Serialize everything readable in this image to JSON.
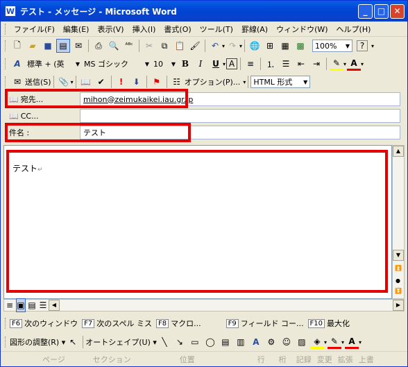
{
  "window": {
    "title": "テスト - メッセージ - Microsoft Word",
    "app_icon": "W"
  },
  "menu": [
    "ファイル(F)",
    "編集(E)",
    "表示(V)",
    "挿入(I)",
    "書式(O)",
    "ツール(T)",
    "罫線(A)",
    "ウィンドウ(W)",
    "ヘルプ(H)"
  ],
  "toolbar": {
    "zoom": "100%",
    "help": "?"
  },
  "format": {
    "style": "標準 + (英",
    "font": "MS ゴシック",
    "size": "10"
  },
  "email_toolbar": {
    "send": "送信(S)",
    "options": "オプション(P)...",
    "format": "HTML 形式"
  },
  "fields": {
    "to_label": "宛先...",
    "to_value": "mihon@zeimukaikei.iau.gr.jp",
    "cc_label": "CC...",
    "cc_value": "",
    "subject_label": "件名 :",
    "subject_value": "テスト"
  },
  "body": {
    "text": "テスト",
    "para_mark": "↵"
  },
  "fkeys": [
    {
      "key": "F6",
      "label": "次のウィンドウ"
    },
    {
      "key": "F7",
      "label": "次のスペル ミス"
    },
    {
      "key": "F8",
      "label": "マクロ..."
    },
    {
      "key": "F9",
      "label": "フィールド コー..."
    },
    {
      "key": "F10",
      "label": "最大化"
    }
  ],
  "draw": {
    "adjust": "図形の調整(R)",
    "autoshape": "オートシェイプ(U)"
  },
  "status": [
    "ページ",
    "セクション",
    "位置",
    "行",
    "桁",
    "記録",
    "変更",
    "拡張",
    "上書"
  ]
}
